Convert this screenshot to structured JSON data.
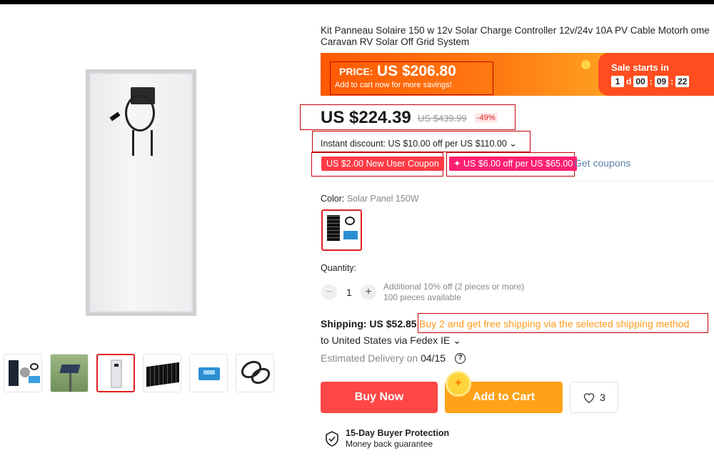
{
  "product": {
    "title": "Kit Panneau Solaire 150 w 12v Solar Charge Controller 12v/24v 10A PV Cable Motorh ome Caravan RV Solar Off Grid System"
  },
  "promo": {
    "price_label": "PRICE:",
    "price_value": "US $206.80",
    "subtext": "Add to cart now for more savings!",
    "sale_label": "Sale starts in",
    "countdown": {
      "days": "1",
      "days_unit": "d",
      "hours": "00",
      "minutes": "09",
      "seconds": "22",
      "sep": ":"
    }
  },
  "pricing": {
    "current": "US $224.39",
    "original": "US $439.99",
    "discount": "-49%",
    "instant_discount": "Instant discount: US $10.00 off per US $110.00 ⌄"
  },
  "coupons": {
    "new_user": "US $2.00 New User Coupon",
    "store": "✦ US $6.00 off per US $65.00",
    "get_coupons": "Get coupons"
  },
  "color": {
    "label": "Color:",
    "value": "Solar Panel 150W"
  },
  "quantity": {
    "label": "Quantity:",
    "minus": "−",
    "value": "1",
    "plus": "+",
    "additional": "Additional 10% off (2 pieces or more)",
    "available": "100 pieces available"
  },
  "shipping": {
    "label": "Shipping: US $52.85",
    "free_promo": "Buy 2 and get free shipping via the selected shipping method",
    "destination": "to United States via Fedex IE ⌄",
    "delivery_label": "Estimated Delivery on ",
    "delivery_date": "04/15",
    "help": "?"
  },
  "actions": {
    "buy_now": "Buy Now",
    "add_to_cart": "Add to Cart",
    "wishlist_count": "3"
  },
  "protection": {
    "title": "15-Day Buyer Protection",
    "subtitle": "Money back guarantee"
  },
  "colors": {
    "accent_red": "#ff4747",
    "cart_orange": "#ffa21a",
    "highlight_box": "#c8000a",
    "free_ship_orange": "#ff9a1a"
  }
}
